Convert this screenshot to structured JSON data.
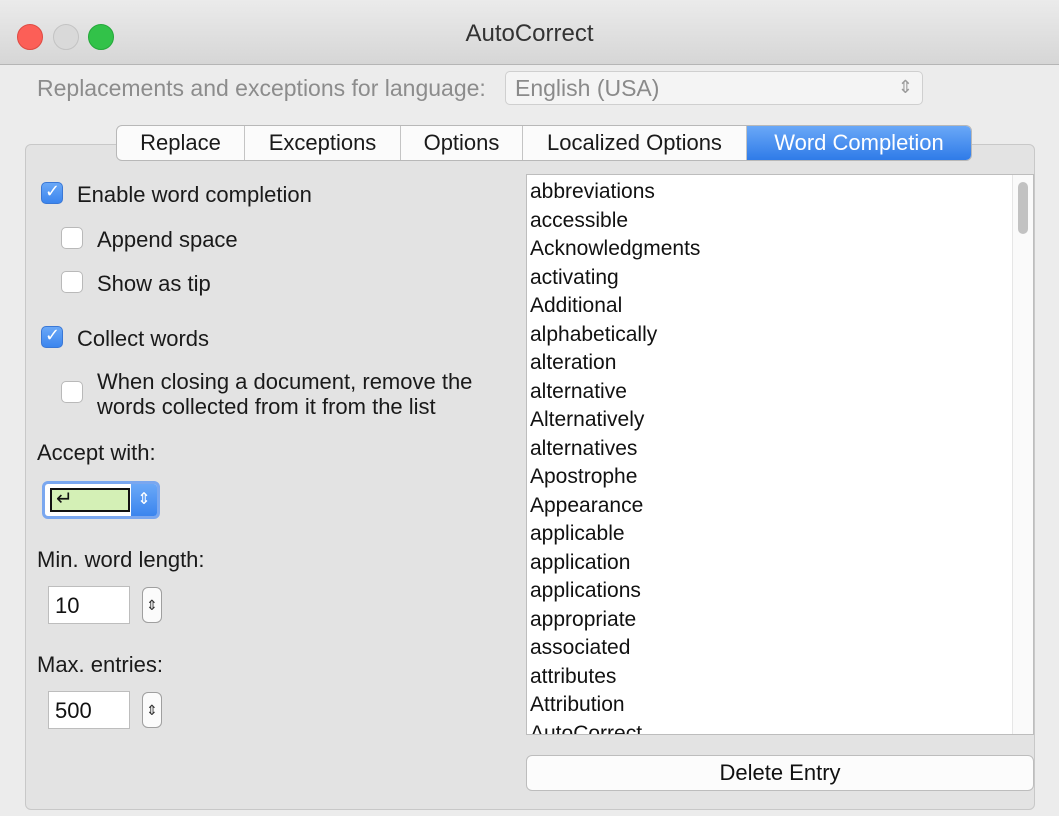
{
  "window": {
    "title": "AutoCorrect"
  },
  "language": {
    "label": "Replacements and exceptions for language:",
    "value": "English (USA)"
  },
  "tabs": [
    {
      "label": "Replace",
      "active": false
    },
    {
      "label": "Exceptions",
      "active": false
    },
    {
      "label": "Options",
      "active": false
    },
    {
      "label": "Localized Options",
      "active": false
    },
    {
      "label": "Word Completion",
      "active": true
    }
  ],
  "options": {
    "enable_word_completion": {
      "label": "Enable word completion",
      "checked": true
    },
    "append_space": {
      "label": "Append space",
      "checked": false
    },
    "show_as_tip": {
      "label": "Show as tip",
      "checked": false
    },
    "collect_words": {
      "label": "Collect words",
      "checked": true
    },
    "remove_on_close": {
      "label_line1": "When closing a document, remove the",
      "label_line2": "words collected from it from the list",
      "checked": false
    }
  },
  "accept_with": {
    "label": "Accept with:",
    "value": "↵"
  },
  "min_word_length": {
    "label": "Min. word length:",
    "value": "10"
  },
  "max_entries": {
    "label": "Max. entries:",
    "value": "500"
  },
  "word_list": [
    "abbreviations",
    "accessible",
    "Acknowledgments",
    "activating",
    "Additional",
    "alphabetically",
    "alteration",
    "alternative",
    "Alternatively",
    "alternatives",
    "Apostrophe",
    "Appearance",
    "applicable",
    "application",
    "applications",
    "appropriate",
    "associated",
    "attributes",
    "Attribution",
    "AutoCorrect"
  ],
  "delete_button": {
    "label": "Delete Entry"
  },
  "colors": {
    "accent": "#3b85ee",
    "accept_key_bg": "#d4f0b6"
  }
}
